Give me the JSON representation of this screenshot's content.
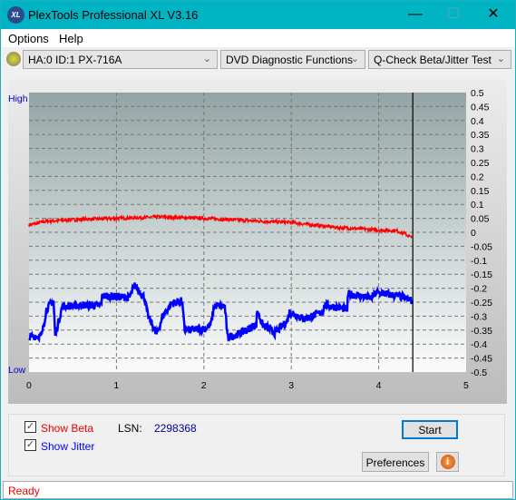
{
  "window": {
    "title": "PlexTools Professional XL V3.16",
    "logo_text": "XL",
    "accent": "#00b4c4"
  },
  "menu": [
    {
      "label": "Options"
    },
    {
      "label": "Help"
    }
  ],
  "toolbar": {
    "drive": "HA:0 ID:1  PX-716A",
    "function": "DVD Diagnostic Functions",
    "test": "Q-Check Beta/Jitter Test"
  },
  "chart_data": {
    "type": "line",
    "xlim": [
      0,
      5
    ],
    "ylim": [
      -0.5,
      0.5
    ],
    "x_ticks": [
      "0",
      "1",
      "2",
      "3",
      "4",
      "5"
    ],
    "y_ticks": [
      "0.5",
      "0.45",
      "0.4",
      "0.35",
      "0.3",
      "0.25",
      "0.2",
      "0.15",
      "0.1",
      "0.05",
      "0",
      "-0.05",
      "-0.1",
      "-0.15",
      "-0.2",
      "-0.25",
      "-0.3",
      "-0.35",
      "-0.4",
      "-0.45",
      "-0.5"
    ],
    "high_label": "High",
    "low_label": "Low",
    "grid": true,
    "cursor_x": 4.39,
    "series": [
      {
        "color": "#ff0000",
        "x": [
          0,
          0.2,
          0.5,
          1.0,
          1.5,
          2.0,
          2.5,
          3.0,
          3.5,
          4.0,
          4.2,
          4.3,
          4.38
        ],
        "y": [
          0.026,
          0.04,
          0.045,
          0.05,
          0.055,
          0.05,
          0.042,
          0.035,
          0.018,
          0.008,
          0.006,
          -0.005,
          -0.02
        ]
      },
      {
        "color": "#0000ff",
        "x": [
          0.007,
          0.145,
          0.2,
          0.28,
          0.3,
          0.38,
          0.63,
          0.82,
          0.84,
          1.15,
          1.21,
          1.32,
          1.36,
          1.46,
          1.53,
          1.63,
          1.75,
          1.78,
          2.01,
          2.08,
          2.12,
          2.24,
          2.27,
          2.43,
          2.6,
          2.61,
          2.67,
          2.81,
          2.95,
          2.98,
          3.15,
          3.36,
          3.38,
          3.64,
          3.65,
          3.91,
          3.98,
          4.26,
          4.38
        ],
        "y": [
          -0.373,
          -0.37,
          -0.275,
          -0.245,
          -0.37,
          -0.265,
          -0.26,
          -0.262,
          -0.227,
          -0.233,
          -0.19,
          -0.233,
          -0.298,
          -0.365,
          -0.3,
          -0.255,
          -0.245,
          -0.35,
          -0.345,
          -0.33,
          -0.262,
          -0.265,
          -0.375,
          -0.36,
          -0.33,
          -0.28,
          -0.33,
          -0.36,
          -0.32,
          -0.285,
          -0.31,
          -0.285,
          -0.26,
          -0.275,
          -0.22,
          -0.235,
          -0.215,
          -0.23,
          -0.245
        ]
      }
    ]
  },
  "controls": {
    "show_beta": "Show Beta",
    "show_jitter": "Show Jitter",
    "show_beta_checked": true,
    "show_jitter_checked": true,
    "lsn_label": "LSN:",
    "lsn_value": "2298368",
    "start": "Start",
    "preferences": "Preferences"
  },
  "status": "Ready"
}
